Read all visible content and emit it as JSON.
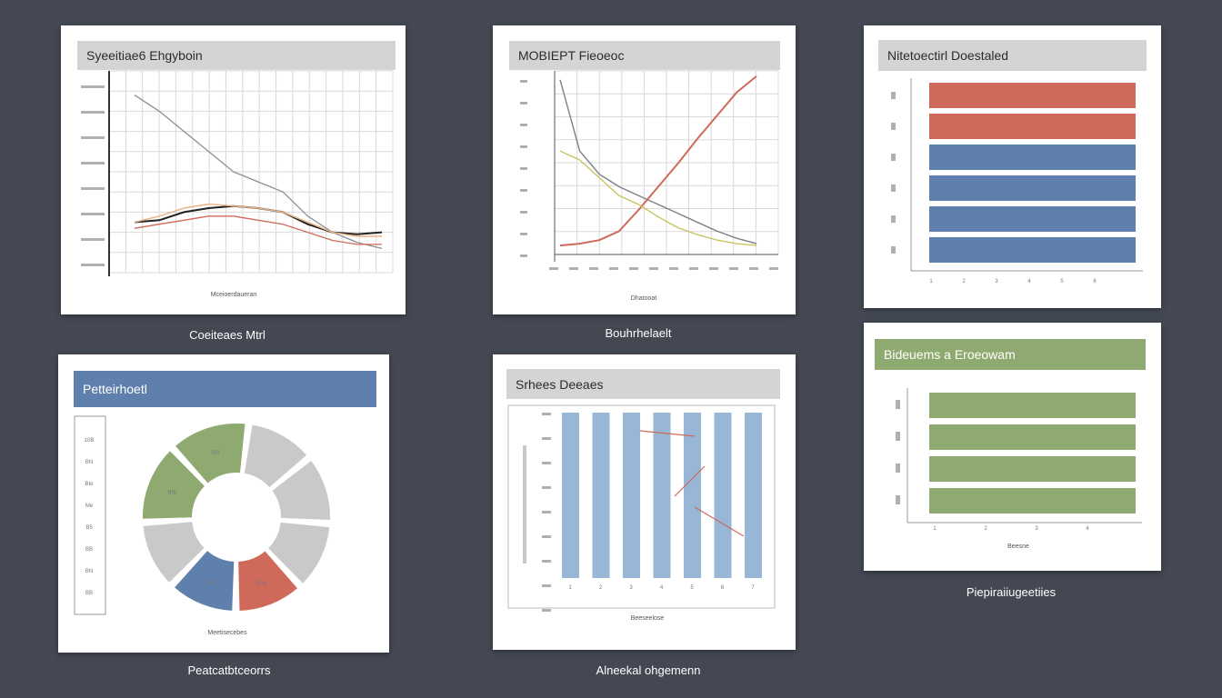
{
  "colors": {
    "background": "#434852",
    "red": "#cf6a5a",
    "blue": "#5f80ad",
    "green": "#8faa70",
    "gray": "#c9c9c9",
    "orange": "#e8b48a",
    "lightblue": "#98b6d6"
  },
  "chart_data": [
    {
      "type": "line",
      "title": "Syeeitiae6 Ehgyboin",
      "xlabel": "Mceioerdaueran",
      "caption": "Coeiteaes Mtrl",
      "x": [
        0,
        1,
        2,
        3,
        4,
        5,
        6,
        7,
        8,
        9,
        10
      ],
      "ylim": [
        0,
        100
      ],
      "series": [
        {
          "values": [
            88,
            80,
            70,
            60,
            50,
            45,
            40,
            28,
            20,
            15,
            12
          ]
        },
        {
          "values": [
            25,
            26,
            30,
            32,
            33,
            32,
            30,
            24,
            20,
            19,
            20
          ]
        },
        {
          "values": [
            25,
            28,
            32,
            34,
            33,
            32,
            30,
            25,
            20,
            18,
            18
          ]
        },
        {
          "values": [
            22,
            24,
            26,
            28,
            28,
            26,
            24,
            20,
            16,
            14,
            14
          ]
        }
      ]
    },
    {
      "type": "line",
      "title": "MOBIEPT Fieoeoc",
      "xlabel": "Dhatooat",
      "caption": "Bouhrhelaelt",
      "x": [
        0,
        1,
        2,
        3,
        4,
        5,
        6,
        7,
        8,
        9,
        10
      ],
      "ylim": [
        0,
        100
      ],
      "series": [
        {
          "values": [
            95,
            55,
            42,
            35,
            30,
            25,
            20,
            15,
            10,
            6,
            3
          ]
        },
        {
          "values": [
            2,
            3,
            5,
            10,
            22,
            35,
            48,
            62,
            75,
            88,
            97
          ]
        },
        {
          "values": [
            55,
            50,
            40,
            30,
            25,
            18,
            12,
            8,
            5,
            3,
            2
          ]
        }
      ]
    },
    {
      "type": "bar",
      "title": "Nitetoectirl Doestaled",
      "caption": "Piepiraiiugeetiies",
      "categories": [
        "1",
        "2",
        "3",
        "4",
        "5",
        "6"
      ],
      "values": [
        100,
        100,
        100,
        100,
        100,
        100
      ],
      "orientation": "horizontal"
    },
    {
      "type": "pie",
      "title": "Petteirhoetl",
      "xlabel": "Meetisecebes",
      "caption": "Peatcatbtceorrs",
      "slice_labels": [
        "BN",
        "BIE",
        "BIE",
        "BSa"
      ],
      "values": [
        14,
        12,
        12,
        12,
        12,
        12,
        12,
        14
      ],
      "ytick_labels": [
        "10B",
        "BN",
        "BIe",
        "Me",
        "B5",
        "BB",
        "BN",
        "BB"
      ]
    },
    {
      "type": "bar",
      "title": "Srhees Deeaes",
      "xlabel": "Beeseelose",
      "caption": "Alneekal ohgemenn",
      "categories": [
        "1",
        "2",
        "3",
        "4",
        "5",
        "6",
        "7"
      ],
      "values": [
        100,
        100,
        100,
        100,
        100,
        100,
        100
      ],
      "ylim": [
        0,
        100
      ]
    },
    {
      "type": "bar",
      "title": "Bideuems a Eroeowam",
      "xlabel": "Beesne",
      "categories": [
        "1",
        "2",
        "3",
        "4"
      ],
      "values": [
        100,
        100,
        100,
        100
      ],
      "orientation": "horizontal"
    }
  ]
}
